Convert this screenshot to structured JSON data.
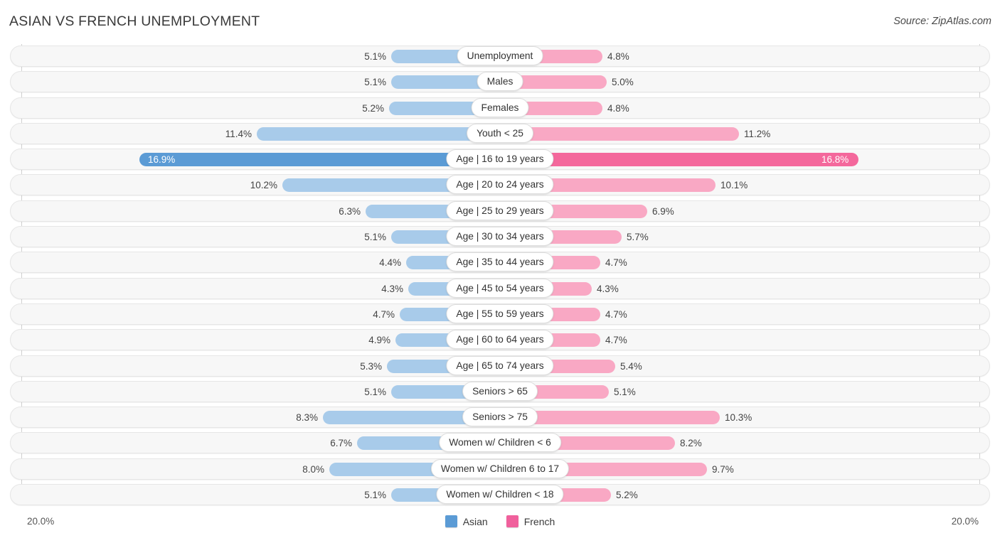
{
  "header": {
    "title": "ASIAN VS FRENCH UNEMPLOYMENT",
    "source": "Source: ZipAtlas.com"
  },
  "footer": {
    "axis_left": "20.0%",
    "axis_right": "20.0%",
    "legend": [
      {
        "label": "Asian",
        "color": "#5b9bd5"
      },
      {
        "label": "French",
        "color": "#f0609c"
      }
    ]
  },
  "colors": {
    "asian_bar": "#a8cbea",
    "french_bar": "#f9a8c4",
    "asian_bar_highlight": "#5b9bd5",
    "french_bar_highlight": "#f4689c",
    "track": "#f7f7f7",
    "pill": "#ffffff"
  },
  "chart_data": {
    "type": "bar",
    "title": "ASIAN VS FRENCH UNEMPLOYMENT",
    "orientation": "horizontal-diverging",
    "xlabel": "",
    "ylabel": "",
    "axis_max_percent": 20.0,
    "legend_position": "bottom-center",
    "grid": false,
    "categories": [
      "Unemployment",
      "Males",
      "Females",
      "Youth < 25",
      "Age | 16 to 19 years",
      "Age | 20 to 24 years",
      "Age | 25 to 29 years",
      "Age | 30 to 34 years",
      "Age | 35 to 44 years",
      "Age | 45 to 54 years",
      "Age | 55 to 59 years",
      "Age | 60 to 64 years",
      "Age | 65 to 74 years",
      "Seniors > 65",
      "Seniors > 75",
      "Women w/ Children < 6",
      "Women w/ Children 6 to 17",
      "Women w/ Children < 18"
    ],
    "series": [
      {
        "name": "Asian",
        "values": [
          5.1,
          5.1,
          5.2,
          11.4,
          16.9,
          10.2,
          6.3,
          5.1,
          4.4,
          4.3,
          4.7,
          4.9,
          5.3,
          5.1,
          8.3,
          6.7,
          8.0,
          5.1
        ],
        "labels": [
          "5.1%",
          "5.1%",
          "5.2%",
          "11.4%",
          "16.9%",
          "10.2%",
          "6.3%",
          "5.1%",
          "4.4%",
          "4.3%",
          "4.7%",
          "4.9%",
          "5.3%",
          "5.1%",
          "8.3%",
          "6.7%",
          "8.0%",
          "5.1%"
        ]
      },
      {
        "name": "French",
        "values": [
          4.8,
          5.0,
          4.8,
          11.2,
          16.8,
          10.1,
          6.9,
          5.7,
          4.7,
          4.3,
          4.7,
          4.7,
          5.4,
          5.1,
          10.3,
          8.2,
          9.7,
          5.2
        ],
        "labels": [
          "4.8%",
          "5.0%",
          "4.8%",
          "11.2%",
          "16.8%",
          "10.1%",
          "6.9%",
          "5.7%",
          "4.7%",
          "4.3%",
          "4.7%",
          "4.7%",
          "5.4%",
          "5.1%",
          "10.3%",
          "8.2%",
          "9.7%",
          "5.2%"
        ]
      }
    ],
    "highlighted_row_index": 4
  }
}
